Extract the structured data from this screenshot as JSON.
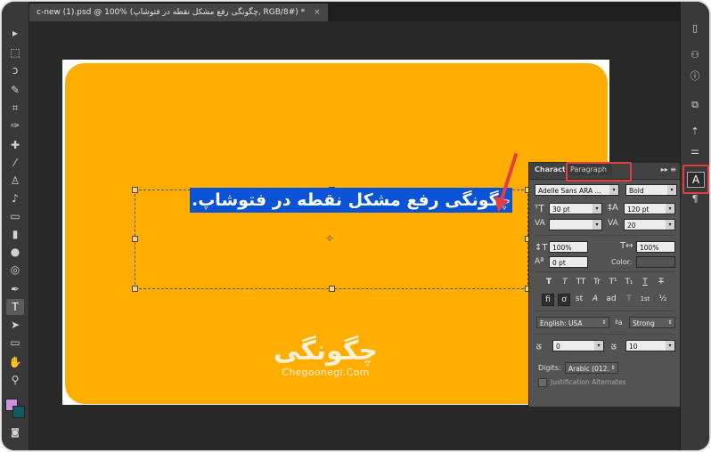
{
  "tab": {
    "title": "c-new (1).psd @ 100% (چگونگی رفع مشکل نقطه در فتوشاپ, RGB/8#) *",
    "close": "×"
  },
  "tools": [
    "move-icon",
    "marquee-icon",
    "lasso-icon",
    "quick-select-icon",
    "crop-icon",
    "eyedropper-icon",
    "healing-icon",
    "brush-icon",
    "stamp-icon",
    "history-brush-icon",
    "eraser-icon",
    "gradient-icon",
    "blur-icon",
    "dodge-icon",
    "pen-icon",
    "type-icon",
    "path-select-icon",
    "shape-icon",
    "hand-icon",
    "zoom-icon"
  ],
  "toolGlyphs": [
    "▸",
    "⬚",
    "ↄ",
    "✎",
    "⌗",
    "✑",
    "✚",
    "⁄",
    "♙",
    "♪",
    "▭",
    "▮",
    "●",
    "◎",
    "✒",
    "T",
    "➤",
    "▭",
    "✋",
    "⚲"
  ],
  "canvas": {
    "headline": "چگونگی رفع مشکل نقطه در فتوشاپ.",
    "watermark_big": "چگونگی",
    "watermark_small": "Chegoonegi.Com",
    "card_color": "#ffae00",
    "selection_color": "#0a52d6"
  },
  "panel": {
    "tab_character": "Character",
    "tab_paragraph": "Paragraph",
    "menu": "▸▸ ≡",
    "font_family": "Adelle Sans ARA ...",
    "font_style": "Bold",
    "font_size": "30 pt",
    "leading": "120 pt",
    "kerning": "",
    "tracking": "20",
    "vertical_scale": "100%",
    "horizontal_scale": "100%",
    "baseline_shift": "0 pt",
    "color_label": "Color:",
    "type_buttons": [
      "T",
      "T",
      "TT",
      "Tr",
      "T¹",
      "T₁",
      "T",
      "T"
    ],
    "ot_buttons": [
      "ﬁ",
      "ơ",
      "st",
      "A",
      "ad",
      "T",
      "1st",
      "½"
    ],
    "language": "English: USA",
    "aa_label": "ªa",
    "antialias": "Strong",
    "kashida_value": "0",
    "diacritic_value": "10",
    "digits_label": "Digits:",
    "digits_value": "Arabic (012...",
    "justification": "Justification Alternates"
  },
  "dock": {
    "icons": [
      "history-icon",
      "swatches-icon",
      "info-icon",
      "clone-source-icon",
      "brush-presets-icon",
      "adjustments-icon",
      "character-panel-icon",
      "paragraph-panel-icon"
    ],
    "glyphs": [
      "▯",
      "⚇",
      "ⓘ",
      "⧉",
      "⇡",
      "⚌",
      "A",
      "¶"
    ]
  },
  "highlight_color": "#e24040"
}
